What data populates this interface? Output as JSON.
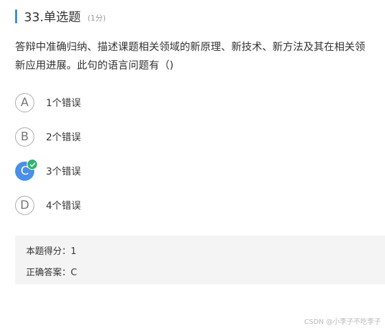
{
  "question": {
    "number_title": "33.单选题",
    "score_note": "(1分)",
    "stem_line1": "答辩中准确归纳、描述课题相关领域的新原理、新技术、新方法及其在相关领",
    "stem_line2": "新应用进展。此句的语言问题有（)"
  },
  "options": [
    {
      "letter": "A",
      "text": "1个错误",
      "selected": false
    },
    {
      "letter": "B",
      "text": "2个错误",
      "selected": false
    },
    {
      "letter": "C",
      "text": "3个错误",
      "selected": true
    },
    {
      "letter": "D",
      "text": "4个错误",
      "selected": false
    }
  ],
  "result": {
    "score_label": "本题得分：",
    "score_value": "1",
    "answer_label": "正确答案：",
    "answer_value": "C"
  },
  "watermark": "CSDN @小李子不吃李子",
  "colors": {
    "accent_bar": "#3a8ee6",
    "selected_option": "#4a8fe8",
    "check_badge": "#2db56e"
  }
}
